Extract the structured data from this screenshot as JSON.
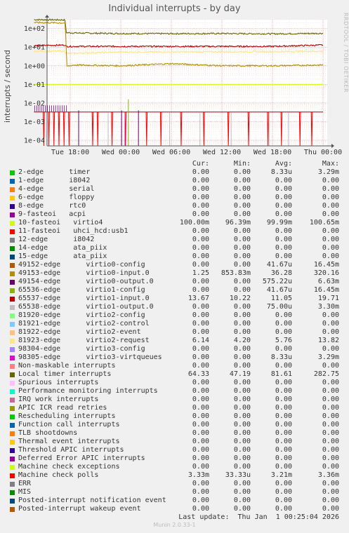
{
  "title": "Individual interrupts - by day",
  "ylabel": "interrupts / second",
  "watermark": "RRDTOOL / TOBI OETIKER",
  "columns": [
    "Cur:",
    "Min:",
    "Avg:",
    "Max:"
  ],
  "legend": [
    {
      "name": "2-edge      timer",
      "color": "#00cc00",
      "cur": "0.00",
      "min": "0.00",
      "avg": "8.33u",
      "max": "3.29m"
    },
    {
      "name": "1-edge      i8042",
      "color": "#0066b3",
      "cur": "0.00",
      "min": "0.00",
      "avg": "0.00",
      "max": "0.00"
    },
    {
      "name": "4-edge      serial",
      "color": "#ff8000",
      "cur": "0.00",
      "min": "0.00",
      "avg": "0.00",
      "max": "0.00"
    },
    {
      "name": "6-edge      floppy",
      "color": "#ffcc00",
      "cur": "0.00",
      "min": "0.00",
      "avg": "0.00",
      "max": "0.00"
    },
    {
      "name": "8-edge      rtc0",
      "color": "#330099",
      "cur": "0.00",
      "min": "0.00",
      "avg": "0.00",
      "max": "0.00"
    },
    {
      "name": "9-fasteoi   acpi",
      "color": "#990099",
      "cur": "0.00",
      "min": "0.00",
      "avg": "0.00",
      "max": "0.00"
    },
    {
      "name": "10-fasteoi   virtio4",
      "color": "#ccff00",
      "cur": "100.00m",
      "min": "96.39m",
      "avg": "99.99m",
      "max": "100.65m"
    },
    {
      "name": "11-fasteoi   uhci_hcd:usb1",
      "color": "#ff0000",
      "cur": "0.00",
      "min": "0.00",
      "avg": "0.00",
      "max": "0.00"
    },
    {
      "name": "12-edge      i8042",
      "color": "#808080",
      "cur": "0.00",
      "min": "0.00",
      "avg": "0.00",
      "max": "0.00"
    },
    {
      "name": "14-edge      ata_piix",
      "color": "#008f00",
      "cur": "0.00",
      "min": "0.00",
      "avg": "0.00",
      "max": "0.00"
    },
    {
      "name": "15-edge      ata_piix",
      "color": "#00487d",
      "cur": "0.00",
      "min": "0.00",
      "avg": "0.00",
      "max": "0.00"
    },
    {
      "name": "49152-edge      virtio0-config",
      "color": "#b35a00",
      "cur": "0.00",
      "min": "0.00",
      "avg": "41.67u",
      "max": "16.45m"
    },
    {
      "name": "49153-edge      virtio0-input.0",
      "color": "#b38f00",
      "cur": "1.25",
      "min": "853.83m",
      "avg": "36.28",
      "max": "320.16"
    },
    {
      "name": "49154-edge      virtio0-output.0",
      "color": "#6b006b",
      "cur": "0.00",
      "min": "0.00",
      "avg": "575.22u",
      "max": "6.63m"
    },
    {
      "name": "65536-edge      virtio1-config",
      "color": "#8fb300",
      "cur": "0.00",
      "min": "0.00",
      "avg": "41.67u",
      "max": "16.45m"
    },
    {
      "name": "65537-edge      virtio1-input.0",
      "color": "#b30000",
      "cur": "13.67",
      "min": "10.22",
      "avg": "11.05",
      "max": "19.71"
    },
    {
      "name": "65538-edge      virtio1-output.0",
      "color": "#bebebe",
      "cur": "0.00",
      "min": "0.00",
      "avg": "75.00u",
      "max": "3.30m"
    },
    {
      "name": "81920-edge      virtio2-config",
      "color": "#80ff80",
      "cur": "0.00",
      "min": "0.00",
      "avg": "0.00",
      "max": "0.00"
    },
    {
      "name": "81921-edge      virtio2-control",
      "color": "#80c9ff",
      "cur": "0.00",
      "min": "0.00",
      "avg": "0.00",
      "max": "0.00"
    },
    {
      "name": "81922-edge      virtio2-event",
      "color": "#ffc080",
      "cur": "0.00",
      "min": "0.00",
      "avg": "0.00",
      "max": "0.00"
    },
    {
      "name": "81923-edge      virtio2-request",
      "color": "#ffe680",
      "cur": "6.14",
      "min": "4.20",
      "avg": "5.76",
      "max": "13.82"
    },
    {
      "name": "98304-edge      virtio3-config",
      "color": "#aa80ff",
      "cur": "0.00",
      "min": "0.00",
      "avg": "0.00",
      "max": "0.00"
    },
    {
      "name": "98305-edge      virtio3-virtqueues",
      "color": "#ee00cc",
      "cur": "0.00",
      "min": "0.00",
      "avg": "8.33u",
      "max": "3.29m"
    },
    {
      "name": "Non-maskable interrupts",
      "color": "#ff8080",
      "cur": "0.00",
      "min": "0.00",
      "avg": "0.00",
      "max": "0.00"
    },
    {
      "name": "Local timer interrupts",
      "color": "#666600",
      "cur": "64.33",
      "min": "47.19",
      "avg": "81.61",
      "max": "282.75"
    },
    {
      "name": "Spurious interrupts",
      "color": "#ffbfff",
      "cur": "0.00",
      "min": "0.00",
      "avg": "0.00",
      "max": "0.00"
    },
    {
      "name": "Performance monitoring interrupts",
      "color": "#00ffcc",
      "cur": "0.00",
      "min": "0.00",
      "avg": "0.00",
      "max": "0.00"
    },
    {
      "name": "IRQ work interrupts",
      "color": "#cc6699",
      "cur": "0.00",
      "min": "0.00",
      "avg": "0.00",
      "max": "0.00"
    },
    {
      "name": "APIC ICR read retries",
      "color": "#999900",
      "cur": "0.00",
      "min": "0.00",
      "avg": "0.00",
      "max": "0.00"
    },
    {
      "name": "Rescheduling interrupts",
      "color": "#00cc00",
      "cur": "0.00",
      "min": "0.00",
      "avg": "0.00",
      "max": "0.00"
    },
    {
      "name": "Function call interrupts",
      "color": "#0066b3",
      "cur": "0.00",
      "min": "0.00",
      "avg": "0.00",
      "max": "0.00"
    },
    {
      "name": "TLB shootdowns",
      "color": "#ff8000",
      "cur": "0.00",
      "min": "0.00",
      "avg": "0.00",
      "max": "0.00"
    },
    {
      "name": "Thermal event interrupts",
      "color": "#ffcc00",
      "cur": "0.00",
      "min": "0.00",
      "avg": "0.00",
      "max": "0.00"
    },
    {
      "name": "Threshold APIC interrupts",
      "color": "#330099",
      "cur": "0.00",
      "min": "0.00",
      "avg": "0.00",
      "max": "0.00"
    },
    {
      "name": "Deferred Error APIC interrupts",
      "color": "#990099",
      "cur": "0.00",
      "min": "0.00",
      "avg": "0.00",
      "max": "0.00"
    },
    {
      "name": "Machine check exceptions",
      "color": "#ccff00",
      "cur": "0.00",
      "min": "0.00",
      "avg": "0.00",
      "max": "0.00"
    },
    {
      "name": "Machine check polls",
      "color": "#ff0000",
      "cur": "3.33m",
      "min": "33.33u",
      "avg": "3.21m",
      "max": "3.36m"
    },
    {
      "name": "ERR",
      "color": "#808080",
      "cur": "0.00",
      "min": "0.00",
      "avg": "0.00",
      "max": "0.00"
    },
    {
      "name": "MIS",
      "color": "#008f00",
      "cur": "0.00",
      "min": "0.00",
      "avg": "0.00",
      "max": "0.00"
    },
    {
      "name": "Posted-interrupt notification event",
      "color": "#00487d",
      "cur": "0.00",
      "min": "0.00",
      "avg": "0.00",
      "max": "0.00"
    },
    {
      "name": "Posted-interrupt wakeup event",
      "color": "#b35a00",
      "cur": "0.00",
      "min": "0.00",
      "avg": "0.00",
      "max": "0.00"
    }
  ],
  "last_update": "Last update:  Thu Jan  1 00:25:04 2026",
  "footer": "Munin 2.0.33-1",
  "chart_data": {
    "type": "line",
    "title": "Individual interrupts - by day",
    "ylabel": "interrupts / second",
    "yscale": "log",
    "ylim": [
      5e-05,
      300
    ],
    "yticks": [
      "1e+02",
      "1e+01",
      "1e+00",
      "1e-01",
      "1e-02",
      "1e-03",
      "1e-04"
    ],
    "ytick_values": [
      100,
      10,
      1,
      0.1,
      0.01,
      0.001,
      0.0001
    ],
    "x_hours_range": [
      -30,
      0
    ],
    "xticks": [
      {
        "label": "Tue 18:00",
        "h": -30
      },
      {
        "label": "Wed 00:00",
        "h": -24
      },
      {
        "label": "Wed 06:00",
        "h": -18
      },
      {
        "label": "Wed 12:00",
        "h": -12
      },
      {
        "label": "Wed 18:00",
        "h": -6
      },
      {
        "label": "Thu 00:00",
        "h": 0
      }
    ],
    "grid": true,
    "series": [
      {
        "name": "Local timer interrupts",
        "color": "#666600",
        "x": [
          -34.3,
          -30.6,
          -30.5,
          -29,
          -24,
          -18,
          -12,
          -6,
          0
        ],
        "y": [
          300,
          290,
          60,
          57,
          54,
          53,
          54,
          52,
          55
        ]
      },
      {
        "name": "65537-edge      virtio1-input.0",
        "color": "#b30000",
        "x": [
          -34.3,
          -30.6,
          -30.5,
          -29,
          -24,
          -18,
          -12,
          -6,
          0
        ],
        "y": [
          12,
          13,
          11,
          11,
          11,
          11,
          11,
          11,
          13
        ]
      },
      {
        "name": "81923-edge      virtio2-request",
        "color": "#ffe680",
        "x": [
          -34.3,
          -30.6,
          -30.5,
          -24,
          -18,
          -12,
          -6,
          0
        ],
        "y": [
          6,
          6,
          4.6,
          5.4,
          5.5,
          5.6,
          5.7,
          6
        ]
      },
      {
        "name": "49153-edge      virtio0-input.0",
        "color": "#b38f00",
        "x": [
          -34.3,
          -30.6,
          -30.4,
          -29.5,
          -24,
          -18,
          -12,
          -6,
          0
        ],
        "y": [
          210,
          200,
          0.95,
          1.1,
          1.0,
          1.3,
          1.0,
          1.0,
          1.1
        ]
      },
      {
        "name": "10-fasteoi   virtio4",
        "color": "#ccff00",
        "x": [
          -34.3,
          0
        ],
        "y": [
          0.1,
          0.1
        ]
      },
      {
        "name": "Machine check polls",
        "color": "#ff0000",
        "x": [
          -34.3,
          0
        ],
        "y": [
          0.0033,
          0.0033
        ]
      }
    ]
  }
}
